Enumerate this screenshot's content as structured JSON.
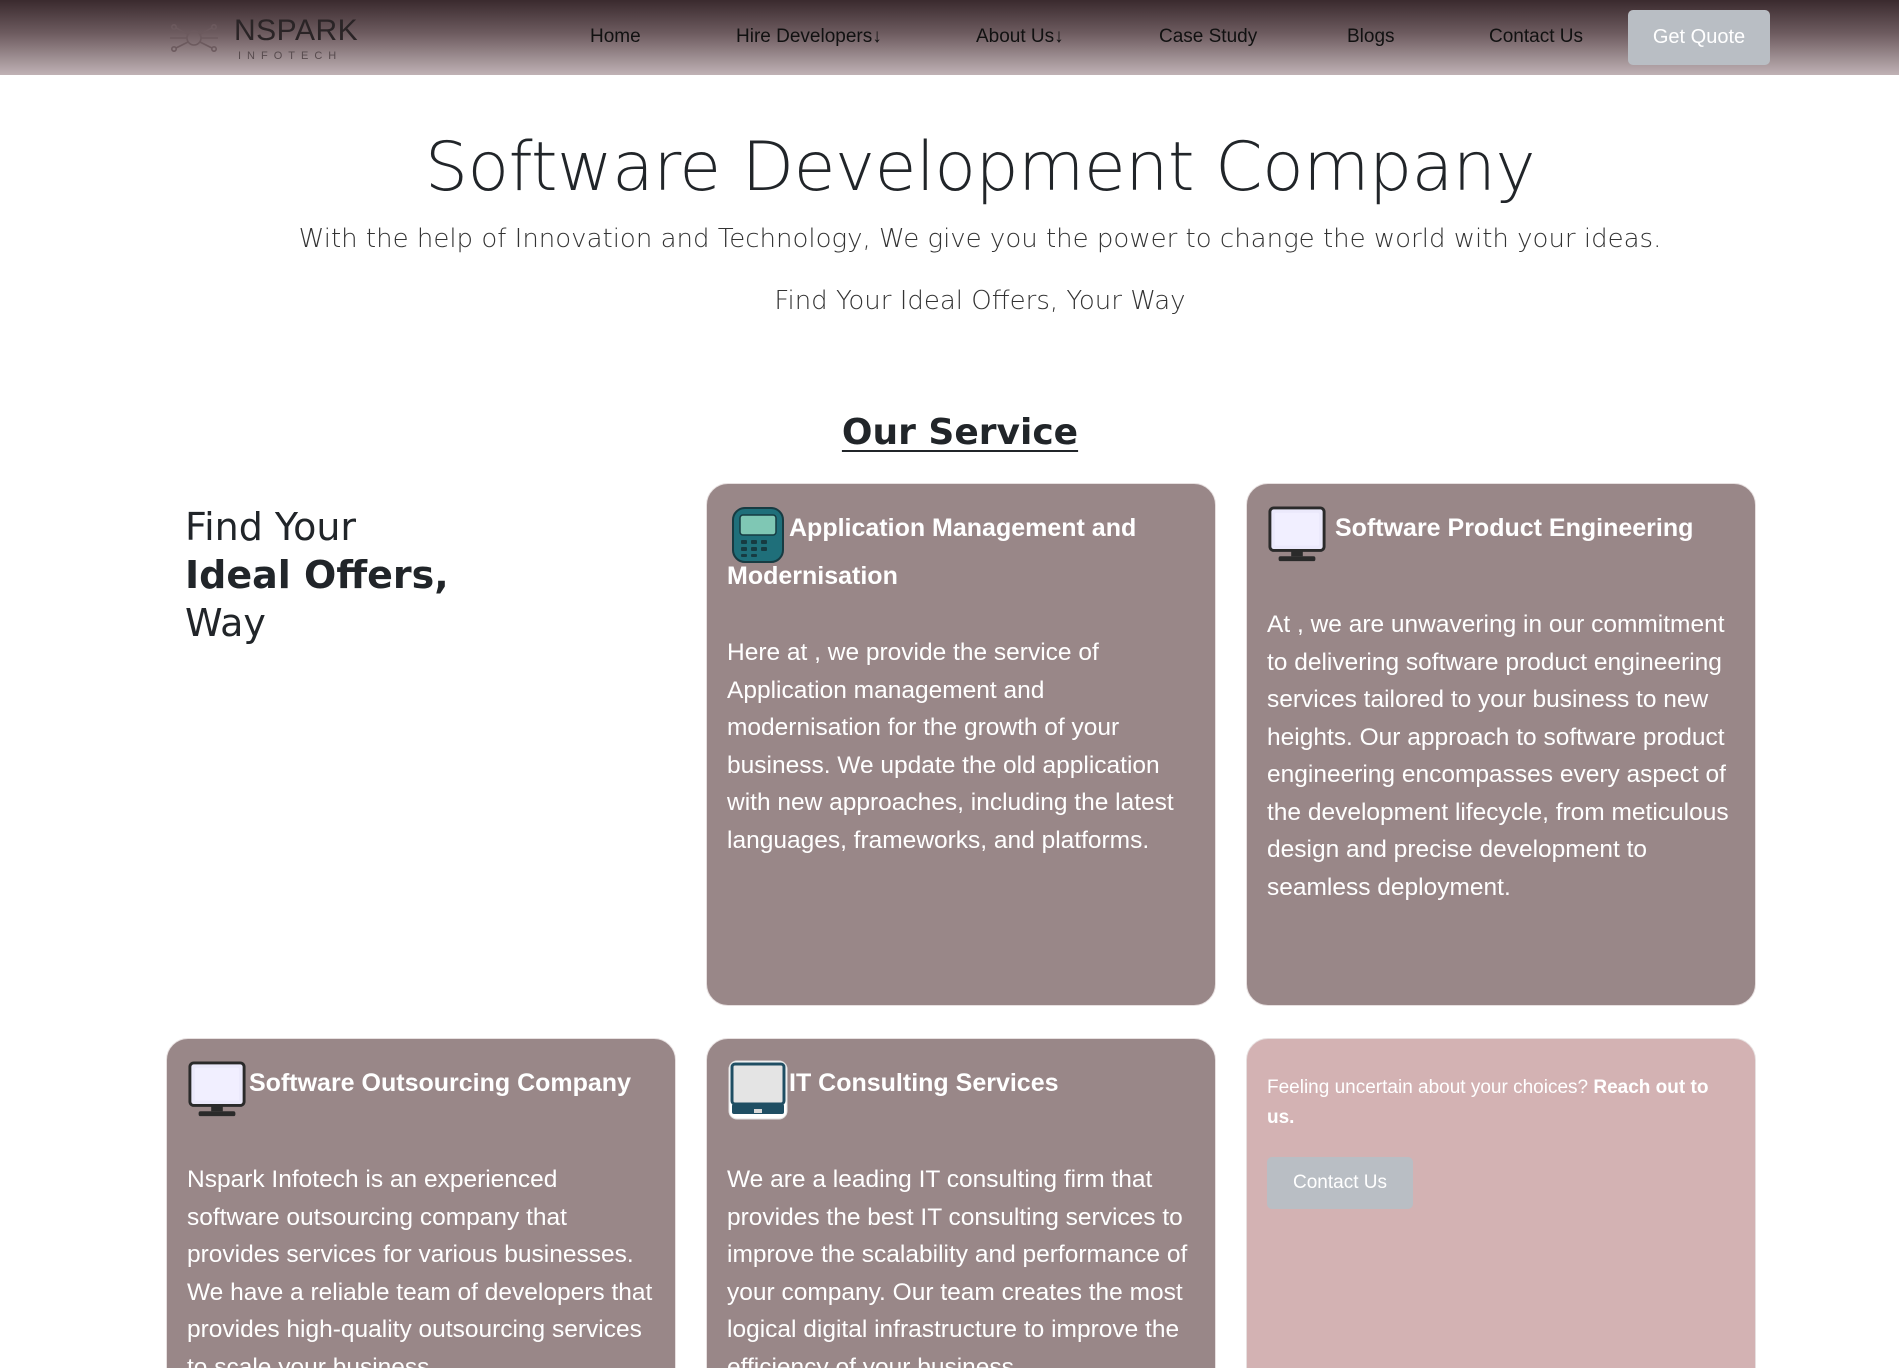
{
  "brand": {
    "name": "NSPARK",
    "sub": "INFOTECH"
  },
  "nav": {
    "items": [
      "Home",
      "Hire Developers↓",
      "About Us↓",
      "Case Study",
      "Blogs",
      "Contact Us"
    ],
    "cta": "Get Quote"
  },
  "hero": {
    "title": "Software Development Company",
    "subtitle": "With the help of Innovation and Technology, We give you the power to change the world with your ideas.",
    "offer": "Find Your Ideal Offers, Your Way"
  },
  "services": {
    "heading": "Our Service",
    "intro": {
      "line1": "Find Your",
      "line2": "Ideal Offers,",
      "line3": "Way"
    },
    "cards": [
      {
        "icon": "pager-device-icon",
        "title": "Application Management and Modernisation",
        "body": "Here at , we provide the service of Application management and modernisation for the growth of your business. We update the old application with new approaches, including the latest languages, frameworks, and platforms."
      },
      {
        "icon": "monitor-icon",
        "title": "Software Product Engineering",
        "body": "At , we are unwavering in our commitment to delivering software product engineering services tailored to your business to new heights. Our approach to software product engineering encompasses every aspect of the development lifecycle, from meticulous design and precise development to seamless deployment."
      },
      {
        "icon": "monitor-icon",
        "title": "Software Outsourcing Company",
        "body": "Nspark Infotech is an experienced software outsourcing company that provides services for various businesses. We have a reliable team of developers that provides high-quality outsourcing services to scale your business."
      },
      {
        "icon": "desktop-computer-icon",
        "title": "IT Consulting Services",
        "body": "We are a leading IT consulting firm that provides the best IT consulting services to improve the scalability and performance of your company. Our team creates the most logical digital infrastructure to improve the efficiency of your business."
      }
    ],
    "cta": {
      "text": "Feeling uncertain about your choices?",
      "strong": "Reach out to us.",
      "button": "Contact Us"
    }
  },
  "colors": {
    "card": "#998788",
    "cta_card": "#d3b2b3",
    "button": "#b9bec4"
  }
}
